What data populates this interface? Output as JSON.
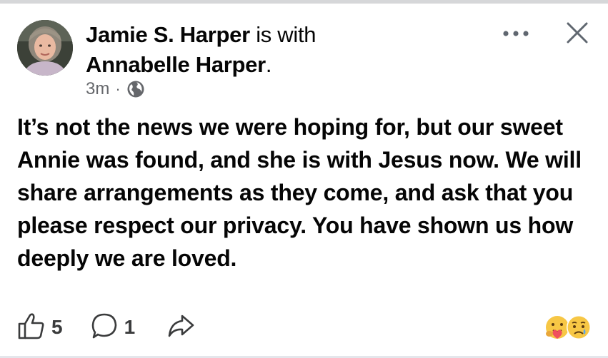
{
  "post": {
    "author": "Jamie S. Harper",
    "with_text": "is with",
    "tagged": "Annabelle Harper",
    "tagged_end": ".",
    "time": "3m",
    "separator": "·",
    "privacy_icon": "globe-icon",
    "text": "It’s not the news we were hoping for, but our sweet Annie was found, and she is with Jesus now. We will share arrangements as they come, and ask that you please respect our privacy. You have shown us how deeply we are loved."
  },
  "header_actions": {
    "more_icon": "more-dots-icon",
    "close_icon": "close-icon"
  },
  "actions": {
    "like_icon": "thumbs-up-icon",
    "like_count": "5",
    "comment_icon": "comment-bubble-icon",
    "comment_count": "1",
    "share_icon": "share-arrow-icon"
  },
  "reactions": [
    "care-emoji-icon",
    "sad-emoji-icon"
  ],
  "colors": {
    "text": "#050505",
    "secondary": "#65676b",
    "icon": "#3a3b3c"
  }
}
